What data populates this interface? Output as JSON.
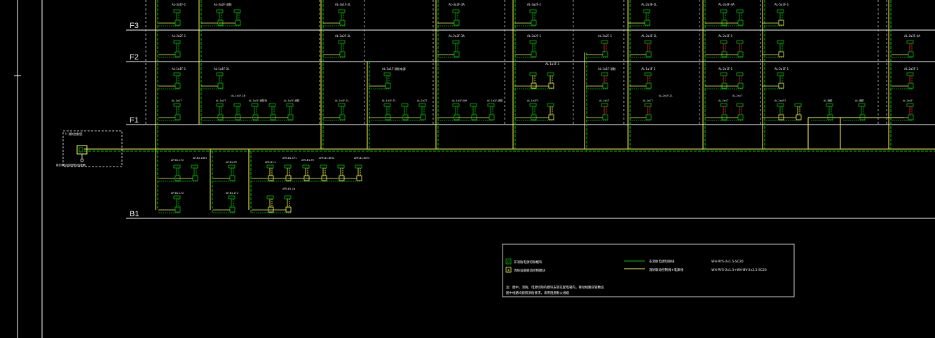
{
  "colors": {
    "background": "#000000",
    "green": "#00c800",
    "yellow": "#ffff4d",
    "red": "#ff2a2a",
    "white": "#ffffff",
    "dashed": "#d0d0d0"
  },
  "floors": [
    "F3",
    "F2",
    "F1",
    "B1"
  ],
  "module_box": {
    "title": "!! 消防控制室",
    "caption": "接至消防控制室联动控制器"
  },
  "legend": {
    "symbol_g_letter": "D",
    "symbol_g_label": "非消防电源切除模块",
    "symbol_y_letter": "X",
    "symbol_y_label": "消防设备联动控制模块",
    "line_g_label": "非消防电源切除线",
    "line_g_cable": "WH-RYS-2x1.5-SC20",
    "line_y_label": "消防联动控制线+电源线",
    "line_y_cable": "WH-RYS-2x1.5+WH-BV-2x2.5-SC20",
    "note_line1": "注：图中，消防，电源切除的模块安装在配电箱内，联动线路穿管敷设",
    "note_line2": "图中线路均按照消防要求，采用阻燃耐火线缆"
  },
  "tags": {
    "f3_a": "AL-3a1F-1",
    "f3_b": "AL-3a2F-消防",
    "f3_c": "AL-3a1F-2L",
    "f3_d": "AL-3a2F-3A",
    "f3_e": "AL-3a2F-1",
    "f3_f": "AL-2a3F-2L",
    "f3_g": "AL-2a4F-4A",
    "f3_h": "AL-5a1F-1",
    "f2_a": "AL-2a2F-1",
    "f2_b": "AL-2a2F-2L",
    "f2_c": "AL-2a2F-3A",
    "f2_d": "AL-2a2F-1",
    "f2_e": "AL-2a2F-1",
    "f2_f": "AL-2a2F-2L",
    "f2_g": "AL-2a2F-1",
    "f2_h": "AL-2a2F-4A",
    "f1u_a": "AL-1a1F-1",
    "f1u_b": "AL-1a1F-2L",
    "f1u_c": "AL-1a1F-消防电源",
    "f1u_d": "AL-1a1F-1",
    "f1u_e": "AL-1a1F-消防",
    "f1u_f": "AL-1a1F-1",
    "f1u_g": "AL-2a1F-1",
    "f1u_h": "AL-2a1F-1",
    "f1u_i": "AL-2a1F-WH",
    "f1u_j": "AL-2a2F-1",
    "f1l_a": "AL-1a2T",
    "f1l_b": "AL-1a2T",
    "f1l_c": "AL-1a1F-1B",
    "f1l_d": "AL-1a1F-消防电",
    "f1l_e": "AL-1a1F-消防",
    "f1l_f": "AL-1a1F-2L",
    "f1l_g": "AL-1a1F-T2",
    "f1l_h": "AL-1a2T",
    "f1l_i": "AL-1a1F-WH",
    "f1l_j": "AL-1a1F-消防",
    "f1l_k": "AL-1a1F2",
    "f1l_l": "AL-2a1T",
    "f1l_m": "AL-2a1T",
    "f1l_n": "AL-2a1F-2L",
    "f1l_o": "AL-2a1T",
    "f1l_p": "AL-2a1T",
    "f1l_q": "AL-2a1F2",
    "f1l_r": "AL-消防",
    "f1l_s": "AL-消防",
    "f1l_t": "AL-2a1F",
    "b1u_a": "AP-B1-1T2",
    "b1u_b": "AP-B1-1WH",
    "b1u_c": "AP-B1-P0",
    "b1u_d": "APE-B1-1",
    "b1u_e": "APE-B1-1P1",
    "b1u_f": "APE-B1-P2",
    "b1u_g": "APE-B1-WH2",
    "b1u_h": "APE-B1-WH3",
    "b1l_a": "AP-B1-1T2",
    "b1l_b": "AP-B1-1T2",
    "b1l_c": "APE-B1-1b"
  }
}
